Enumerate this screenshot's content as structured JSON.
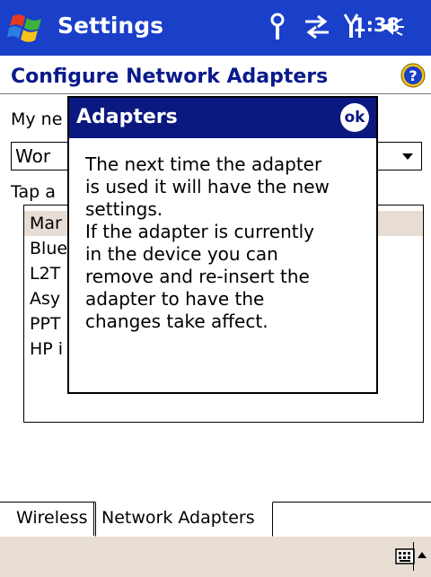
{
  "titlebar": {
    "app_title": "Settings",
    "clock": "1:38",
    "icons": [
      "start-flag-icon",
      "antenna-icon",
      "sync-arrows-icon",
      "signal-icon",
      "speaker-icon"
    ]
  },
  "header": {
    "title": "Configure Network Adapters",
    "help_icon": "help-icon"
  },
  "form": {
    "network_label": "My ne",
    "dropdown_value": "Wor",
    "tap_label": "Tap a",
    "adapters": [
      "Mar",
      "Blue",
      "L2T",
      "Asy",
      "PPT",
      "HP i"
    ]
  },
  "popup": {
    "title": "Adapters",
    "ok_label": "ok",
    "message": "The next time the adapter\nis used it will have the new\nsettings.\nIf the adapter is currently\nin the device you can\nremove and re-insert the\nadapter to have the\nchanges take affect."
  },
  "tabs": [
    {
      "label": "Wireless",
      "active": false
    },
    {
      "label": "Network Adapters",
      "active": true
    }
  ],
  "menubar": {
    "keyboard_icon": "keyboard-icon"
  },
  "colors": {
    "titlebar": "#1a3fc8",
    "popup_title": "#0b1880",
    "page_title": "#0a1a8c",
    "menubar": "#e9ded4"
  }
}
